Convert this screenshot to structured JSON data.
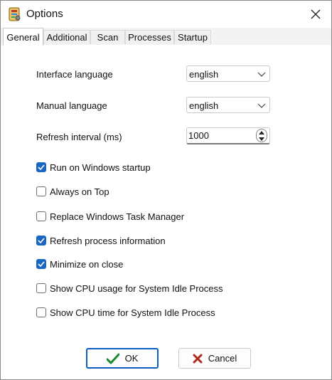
{
  "window": {
    "title": "Options"
  },
  "tabs": [
    {
      "label": "General",
      "active": true
    },
    {
      "label": "Additional",
      "active": false
    },
    {
      "label": "Scan",
      "active": false
    },
    {
      "label": "Processes",
      "active": false
    },
    {
      "label": "Startup",
      "active": false
    }
  ],
  "general": {
    "interface_language": {
      "label": "Interface language",
      "value": "english"
    },
    "manual_language": {
      "label": "Manual language",
      "value": "english"
    },
    "refresh_interval": {
      "label": "Refresh interval (ms)",
      "value": "1000"
    },
    "checkboxes": [
      {
        "label": "Run on Windows startup",
        "checked": true
      },
      {
        "label": "Always on Top",
        "checked": false
      },
      {
        "label": "Replace Windows Task Manager",
        "checked": false
      },
      {
        "label": "Refresh process information",
        "checked": true
      },
      {
        "label": "Minimize on close",
        "checked": true
      },
      {
        "label": "Show CPU usage for System Idle Process",
        "checked": false
      },
      {
        "label": "Show CPU time for System Idle Process",
        "checked": false
      }
    ]
  },
  "buttons": {
    "ok_label": "OK",
    "cancel_label": "Cancel"
  },
  "colors": {
    "accent": "#1a66c4",
    "ok_check": "#1a8a2e",
    "cancel_x": "#b3261e"
  },
  "icons": {
    "app": "app-tool-icon",
    "close": "close-icon",
    "ok": "checkmark-icon",
    "cancel": "x-icon"
  }
}
